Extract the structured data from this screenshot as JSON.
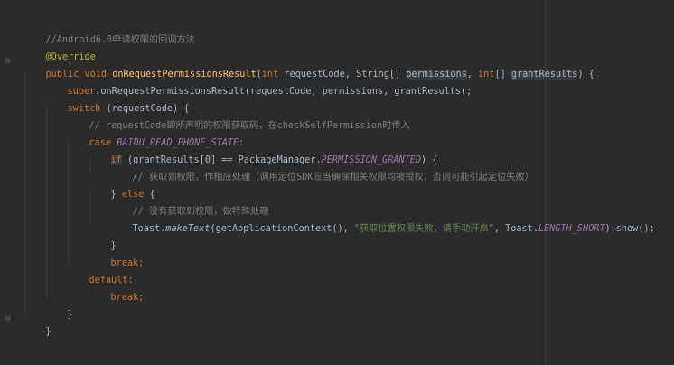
{
  "code": {
    "comment_header": "//Android6.0申请权限的回调方法",
    "annotation": "@Override",
    "sig": {
      "public": "public",
      "void": "void",
      "name": "onRequestPermissionsResult",
      "open": "(",
      "int1": "int",
      "p1": " requestCode, String[] ",
      "p2": "permissions",
      "comma": ", ",
      "int2": "int",
      "br": "[] ",
      "p3": "grantResults",
      "close": ") {"
    },
    "super_kw": "super",
    "super_rest": ".onRequestPermissionsResult(requestCode, permissions, grantResults);",
    "switch_kw": "switch",
    "switch_rest": " (requestCode) {",
    "comment_request": "// requestCode即所声明的权限获取码，在checkSelfPermission时传入",
    "case_kw": "case",
    "case_const": "BAIDU_READ_PHONE_STATE",
    "case_colon": ":",
    "if_kw": "if",
    "if_rest": " (grantResults[0] == PackageManager.",
    "if_const": "PERMISSION_GRANTED",
    "if_end": ") {",
    "comment_granted": "// 获取到权限，作相应处理（调用定位SDK应当确保相关权限均被授权，否则可能引起定位失败）",
    "close_brace": "}",
    "else_kw": "else",
    "else_open": " {",
    "comment_denied": "// 没有获取到权限，做特殊处理",
    "toast_a": "Toast.",
    "toast_method": "makeText",
    "toast_b": "(getApplicationContext(), ",
    "toast_str": "\"获取位置权限失败，请手动开启\"",
    "toast_c": ", Toast.",
    "toast_const": "LENGTH_SHORT",
    "toast_d": ").show();",
    "break_kw": "break",
    "semi": ";",
    "default_kw": "default",
    "default_colon": ":"
  }
}
